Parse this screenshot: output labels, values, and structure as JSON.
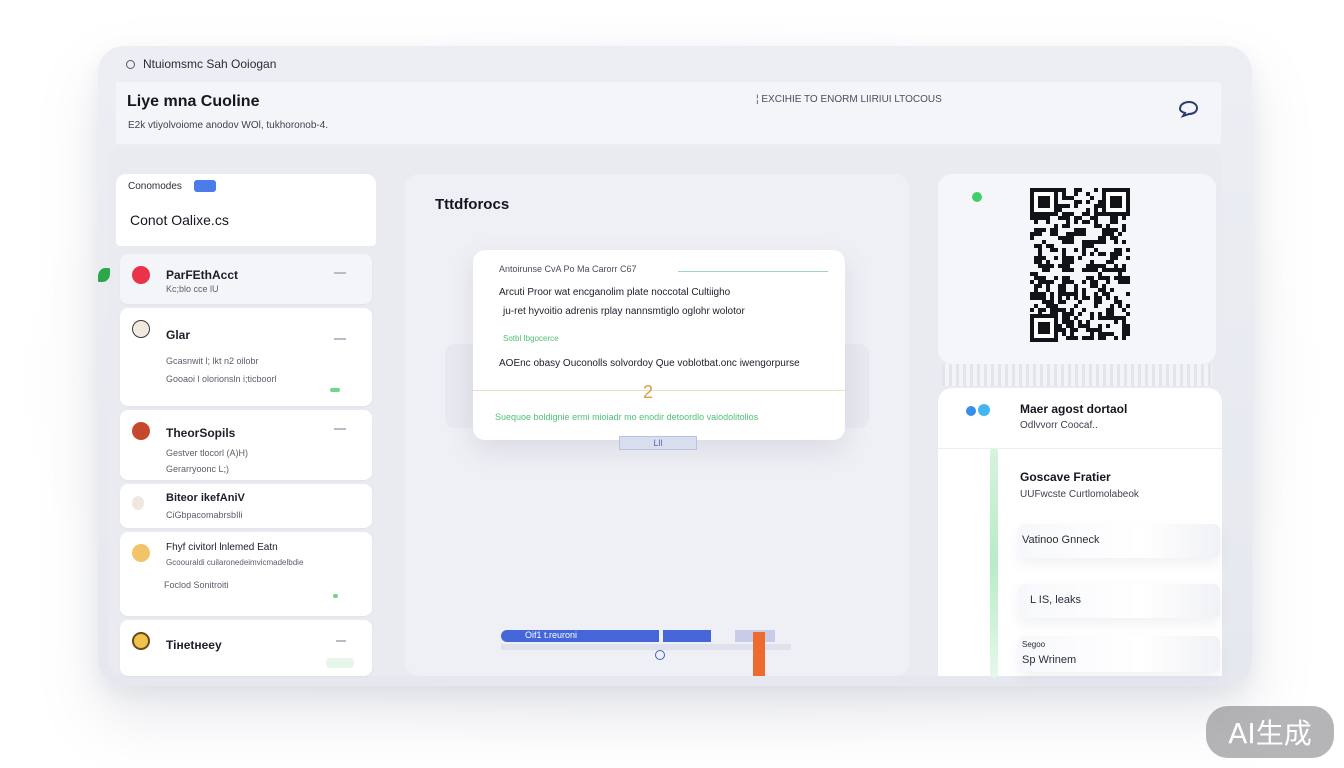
{
  "window": {
    "title": "Ntuiomsmc  Sah Ooiogan"
  },
  "header": {
    "title": "Liye mna Cuoline",
    "subtitle": "E2k vtiyolvoiome anodov WOl, tukhoronob-4.",
    "meta": "¦  EXCIHIE  TO  ENORM  LIIRIUI  LTOCOUS"
  },
  "contacts_panel": {
    "tag": "Conomodes",
    "name": "Conot Oalixe.cs",
    "items": [
      {
        "name": "ParFEthAcct",
        "line1": "Kc;blo cce lU",
        "line2": ""
      },
      {
        "name": "Glar",
        "line1": "Gcasnwit l;  lkt n2 oilobr",
        "line2": "Gooaoi l olorionsln i;ticboorl"
      },
      {
        "name": "TheorSopils",
        "line1": "Gestver tlocorl (A)H)",
        "line2": "Gerarryoonc  L;)"
      },
      {
        "name": "Biteor ikefAniV",
        "line1": "CiGbpacomabrsbIli",
        "line2": ""
      },
      {
        "name": "Fhyf civitorl lnlemed Eatn",
        "line1": "Gcoouraldi cuilaronedeimvicmadelbdie",
        "line2": "Foclod Sonitroiti"
      },
      {
        "name": "Tiнetнeey",
        "line1": "",
        "line2": ""
      }
    ]
  },
  "message_panel": {
    "title": "Tttdforocs",
    "card": {
      "header": "Antoirunse CvA Po Ma Carorr C67",
      "body1": "Arcuti Proor wat encganolim plate noccotal Cultiigho",
      "body2": "ju-ret hyvoitio adrenis rplay nannsmtiglo oglohr wolotor",
      "small": "Sotbl Ibgocerce",
      "body3": "AOEnc obasy Ouconolls solvordoy Que voblotbat.onc iwengorpurse",
      "number": "2",
      "footer": "Suequoe boldignie ermi mioiadr mo enodir detoordlo vaiodolitolios"
    },
    "tab_label": "Lll",
    "progress_label": "Oif1 t.reuroni"
  },
  "right_panel": {
    "items": [
      {
        "title": "Maer agost dortaol",
        "sub": "Odlvvorr Coocaf.."
      },
      {
        "title": "Goscave Fratier",
        "sub": "UUFwcste Curtlomolabeok"
      }
    ],
    "rows": [
      "Vatinoo Gnneck",
      "L IS, leaks",
      "  Sp  Wrinem"
    ],
    "row3_prefix": "Segoo"
  },
  "watermark": "AI生成",
  "colors": {
    "accent_blue": "#4466d8",
    "accent_green": "#4fbf77",
    "accent_orange": "#ee6a2f",
    "gold": "#d8a23a"
  }
}
